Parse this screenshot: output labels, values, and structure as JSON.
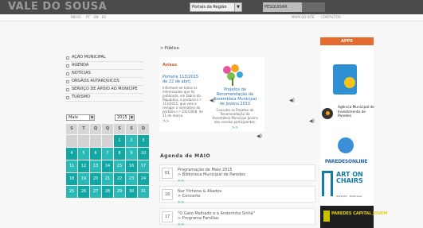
{
  "header": {
    "brand": "VALE DO SOUSA",
    "portal_select": "Portais da Região",
    "search_label": "PESQUISAR",
    "subnav": [
      "INÍCIO",
      "PT",
      "EN",
      "ES",
      "MAPA DO SITE",
      "CONTACTOS"
    ]
  },
  "menu": {
    "items": [
      "AÇÃO MUNICIPAL",
      "AGENDA",
      "NOTÍCIAS",
      "ORGÃOS AUTARQUICOS",
      "SERVIÇO DE APOIO AO MUNICÍPE",
      "TURISMO"
    ]
  },
  "calendar": {
    "month": "Maio",
    "year": "2015",
    "weekdays": [
      "S",
      "T",
      "Q",
      "Q",
      "S",
      "S",
      "D"
    ],
    "weeks": [
      [
        "",
        "",
        "",
        "",
        "1",
        "2",
        "3"
      ],
      [
        "4",
        "5",
        "6",
        "7",
        "8",
        "9",
        "10"
      ],
      [
        "11",
        "12",
        "13",
        "14",
        "15",
        "16",
        "17"
      ],
      [
        "18",
        "19",
        "20",
        "21",
        "22",
        "23",
        "24"
      ],
      [
        "25",
        "26",
        "27",
        "28",
        "29",
        "30",
        "31"
      ]
    ]
  },
  "main": {
    "breadcrumb": "> Público",
    "notices_title": "Avisos",
    "notice_left": {
      "heading": "Portaria 113/2015 de 22 de abril.",
      "body": "Informam-se todos os interessados que foi publicada, em Diário da República, a portaria n.º 113/2015, que veio a revogar o normativo da portaria n.º 232/2008, de 11 de março.",
      "more": ">>"
    },
    "notice_right": {
      "heading": "Projetos de Recomendação da Assembleia Municipal de Jovens 2015",
      "body": "Consulte os Projetos de Recomendação da Assembleia Municipal Jovens das escolas participantes.",
      "more": ">>"
    },
    "agenda_title": "Agenda de MAIO",
    "agenda": [
      {
        "day": "01",
        "text": "Programação de Maio 2015",
        "sub": "> Biblioteca Municipal de Paredes",
        "more": ">>"
      },
      {
        "day": "16",
        "text": "Nur Ytrhena & Aliados",
        "sub": "> Concerto",
        "more": ">>"
      },
      {
        "day": "17",
        "text": "\"O Gato Malhado e a Andorinha Sinhá\"",
        "sub": "> Programa Famílias",
        "more": ">>"
      }
    ]
  },
  "sidebar": {
    "apps_header": "APPS",
    "agency_text": "Agência Municipal de Investimento de Paredes",
    "paredes_online": "PAREDESONLINE",
    "art_chairs": "ART ON CHAIRS",
    "art_sub": "PAREDES · PORTUGAL",
    "capital_text": "PAREDES CAPITAL JOVEM"
  }
}
